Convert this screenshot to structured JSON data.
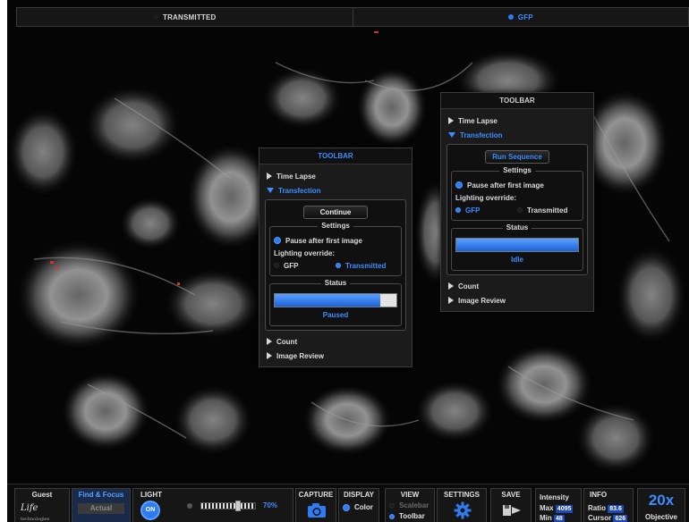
{
  "channels": [
    {
      "label": "TRANSMITTED",
      "active": false
    },
    {
      "label": "GFP",
      "active": true
    }
  ],
  "toolbar_left": {
    "title": "TOOLBAR",
    "time_lapse": "Time Lapse",
    "transfection": "Transfection",
    "action_button": "Continue",
    "settings_legend": "Settings",
    "pause_label": "Pause after first image",
    "lighting_label": "Lighting override:",
    "opt_gfp": "GFP",
    "opt_transmitted": "Transmitted",
    "selected_light": "Transmitted",
    "status_legend": "Status",
    "progress": 0.87,
    "status_text": "Paused",
    "count": "Count",
    "image_review": "Image Review"
  },
  "toolbar_right": {
    "title": "TOOLBAR",
    "time_lapse": "Time Lapse",
    "transfection": "Transfection",
    "action_button": "Run Sequence",
    "settings_legend": "Settings",
    "pause_label": "Pause after first image",
    "lighting_label": "Lighting override:",
    "opt_gfp": "GFP",
    "opt_transmitted": "Transmitted",
    "selected_light": "GFP",
    "status_legend": "Status",
    "progress": 1.0,
    "status_text": "Idle",
    "count": "Count",
    "image_review": "Image Review"
  },
  "bottom": {
    "user": {
      "name": "Guest",
      "logo_text": "Life",
      "logo_sub": "technologies"
    },
    "find_focus": {
      "label": "Find & Focus",
      "actual": "Actual"
    },
    "light": {
      "label": "LIGHT",
      "toggle": "ON",
      "percent": "70%"
    },
    "capture": {
      "label": "CAPTURE",
      "icon": "camera-icon"
    },
    "display": {
      "label": "DISPLAY",
      "mode": "Color"
    },
    "view": {
      "label": "VIEW",
      "scalebar": "Scalebar",
      "toolbar": "Toolbar"
    },
    "settings": {
      "label": "SETTINGS",
      "icon": "gear-icon"
    },
    "save": {
      "label": "SAVE",
      "icon": "save-export-icon"
    },
    "intensity": {
      "label": "Intensity",
      "max_label": "Max",
      "max": "4095",
      "min_label": "Min",
      "min": "48"
    },
    "info": {
      "label": "INFO",
      "ratio_label": "Ratio",
      "ratio": "83.6",
      "cursor_label": "Cursor",
      "cursor": "626"
    },
    "objective": {
      "value": "20x",
      "label": "Objective"
    }
  },
  "colors": {
    "accent": "#3c8dff",
    "progress": "#2f7cf0",
    "field_bg": "#1d47b5"
  }
}
